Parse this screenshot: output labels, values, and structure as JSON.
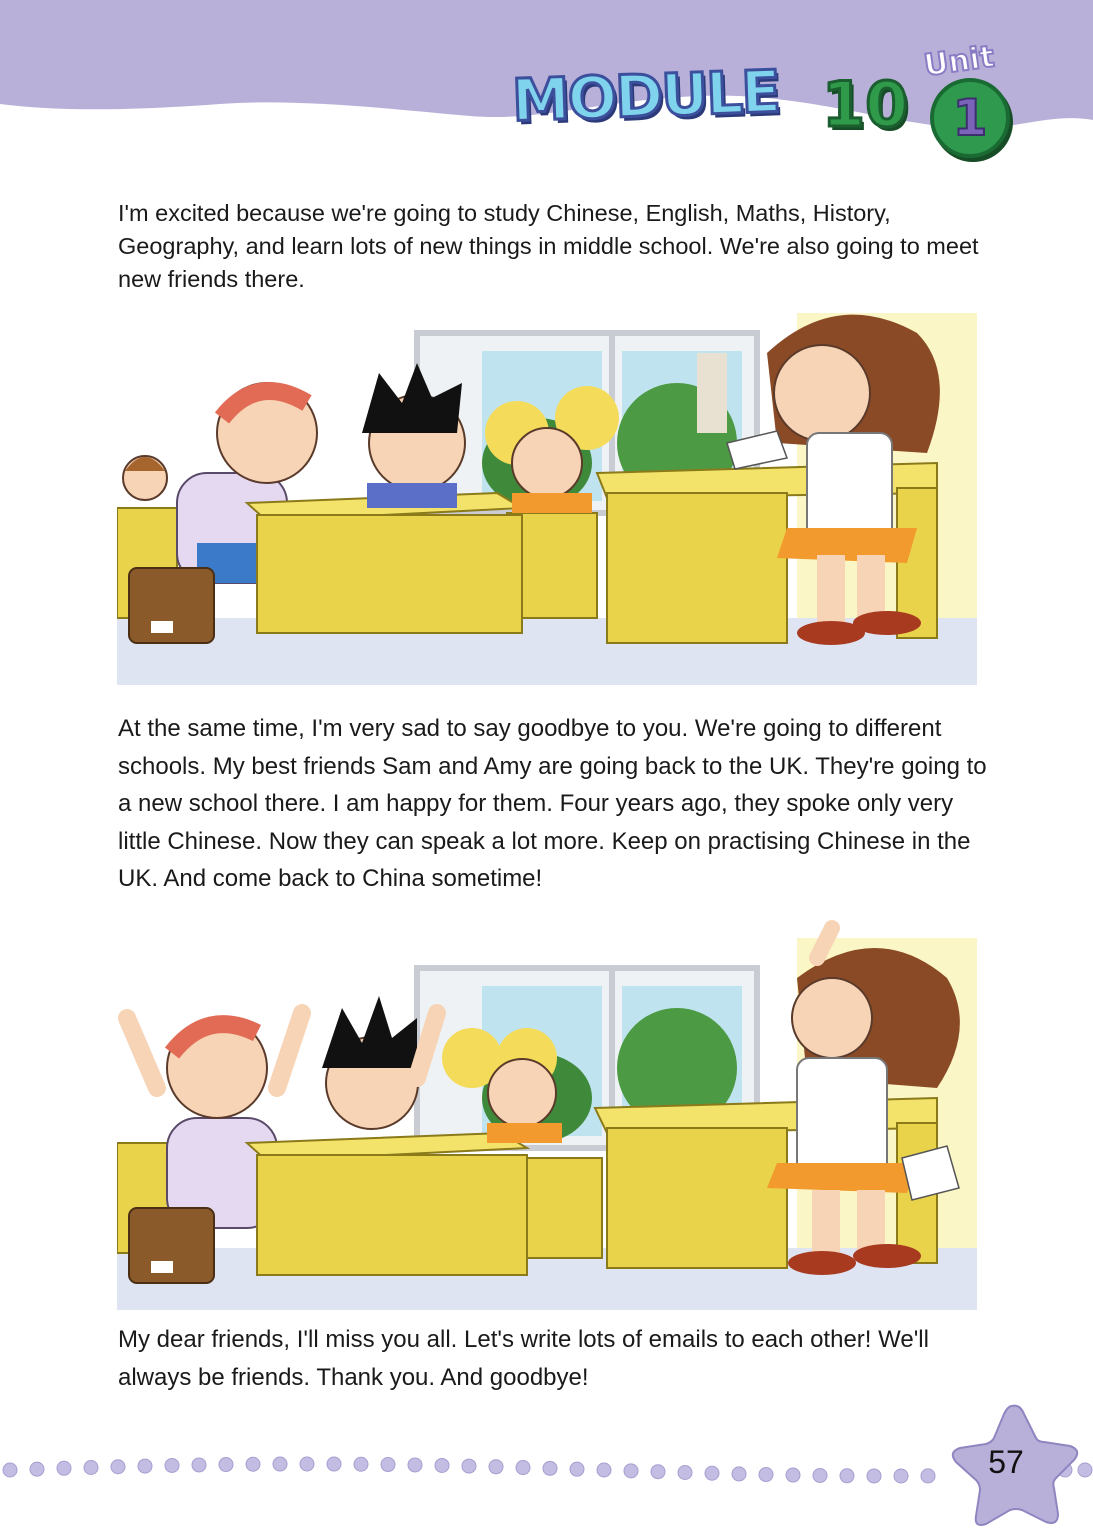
{
  "header": {
    "module_label": "MODULE",
    "module_number": "10",
    "unit_label": "Unit",
    "unit_number": "1",
    "band_color": "#b9b0d9"
  },
  "content": {
    "paragraph_1": "I'm excited because we're going to study Chinese, English, Maths, History, Geography, and learn lots of new things in middle school. We're also going to meet new friends there.",
    "paragraph_2": "At the same time, I'm very sad to say goodbye to you. We're going to different schools. My best friends Sam and Amy are going back to the UK. They're going to a new school there. I am happy for them. Four years ago, they spoke only very little Chinese. Now they can speak a lot more. Keep on practising Chinese in the UK. And come back to China sometime!",
    "paragraph_3": "My dear friends, I'll miss you all. Let's write lots of emails to each other! We'll always be friends. Thank you. And goodbye!"
  },
  "footer": {
    "page_number": "57",
    "star_color": "#b9b0d9"
  }
}
